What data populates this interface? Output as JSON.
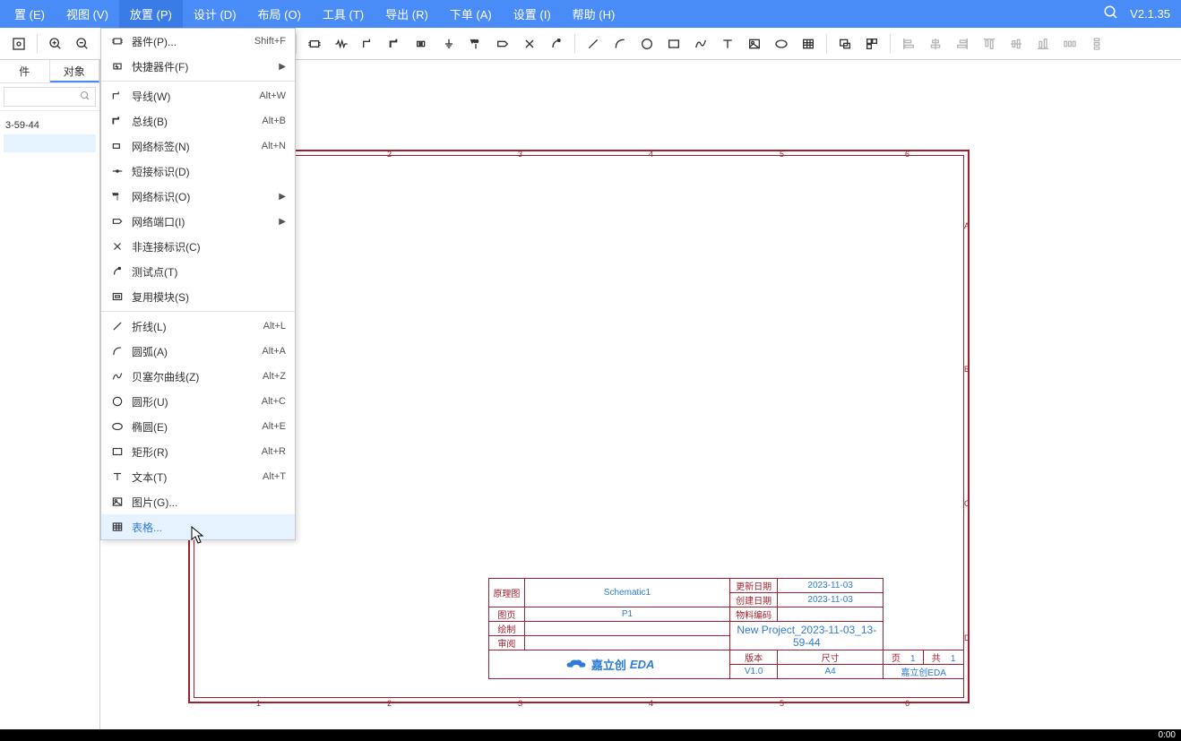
{
  "version": "V2.1.35",
  "menu": {
    "items": [
      {
        "label": "置 (E)",
        "name": "menu-edit"
      },
      {
        "label": "视图 (V)",
        "name": "menu-view"
      },
      {
        "label": "放置 (P)",
        "name": "menu-place",
        "active": true
      },
      {
        "label": "设计 (D)",
        "name": "menu-design"
      },
      {
        "label": "布局 (O)",
        "name": "menu-layout"
      },
      {
        "label": "工具 (T)",
        "name": "menu-tools"
      },
      {
        "label": "导出 (R)",
        "name": "menu-export"
      },
      {
        "label": "下单 (A)",
        "name": "menu-order"
      },
      {
        "label": "设置 (I)",
        "name": "menu-settings"
      },
      {
        "label": "帮助 (H)",
        "name": "menu-help"
      }
    ]
  },
  "leftpanel": {
    "tab1": "件",
    "tab2": "对象",
    "proj_label": "3-59-44"
  },
  "dropdown": {
    "groups": [
      [
        {
          "label": "器件(P)...",
          "shortcut": "Shift+F",
          "icon": "component-icon"
        },
        {
          "label": "快捷器件(F)",
          "submenu": true,
          "icon": "quick-component-icon"
        }
      ],
      [
        {
          "label": "导线(W)",
          "shortcut": "Alt+W",
          "icon": "wire-icon"
        },
        {
          "label": "总线(B)",
          "shortcut": "Alt+B",
          "icon": "bus-icon"
        },
        {
          "label": "网络标签(N)",
          "shortcut": "Alt+N",
          "icon": "netlabel-icon"
        },
        {
          "label": "短接标识(D)",
          "icon": "short-icon"
        },
        {
          "label": "网络标识(O)",
          "submenu": true,
          "icon": "netflag-icon"
        },
        {
          "label": "网络端口(I)",
          "submenu": true,
          "icon": "netport-icon"
        },
        {
          "label": "非连接标识(C)",
          "icon": "noconnect-icon"
        },
        {
          "label": "测试点(T)",
          "icon": "testpoint-icon"
        },
        {
          "label": "复用模块(S)",
          "icon": "reuse-icon"
        }
      ],
      [
        {
          "label": "折线(L)",
          "shortcut": "Alt+L",
          "icon": "polyline-icon"
        },
        {
          "label": "圆弧(A)",
          "shortcut": "Alt+A",
          "icon": "arc-icon"
        },
        {
          "label": "贝塞尔曲线(Z)",
          "shortcut": "Alt+Z",
          "icon": "bezier-icon"
        },
        {
          "label": "圆形(U)",
          "shortcut": "Alt+C",
          "icon": "circle-icon"
        },
        {
          "label": "椭圆(E)",
          "shortcut": "Alt+E",
          "icon": "ellipse-icon"
        },
        {
          "label": "矩形(R)",
          "shortcut": "Alt+R",
          "icon": "rect-icon"
        },
        {
          "label": "文本(T)",
          "shortcut": "Alt+T",
          "icon": "text-icon"
        },
        {
          "label": "图片(G)...",
          "icon": "image-icon"
        },
        {
          "label": "表格...",
          "icon": "table-icon",
          "hover": true
        }
      ]
    ]
  },
  "titleblock": {
    "r1c1": "原理图",
    "r1c2": "Schematic1",
    "r1c3": "更新日期",
    "r1c4": "2023-11-03",
    "r2c3": "创建日期",
    "r2c4": "2023-11-03",
    "r3c1": "图页",
    "r3c2": "P1",
    "r3c3": "物料编码",
    "r4c1": "绘制",
    "r5c1": "审阅",
    "proj_name": "New Project_2023-11-03_13-59-44",
    "r6c1": "版本",
    "r6c2": "尺寸",
    "r6c3": "页",
    "r6c3v": "1",
    "r6c4": "共",
    "r6c4v": "1",
    "brand_cn": "嘉立创",
    "brand_en": "EDA",
    "r7c1": "V1.0",
    "r7c2": "A4",
    "r7c3": "嘉立创EDA"
  },
  "clock": "0:00"
}
